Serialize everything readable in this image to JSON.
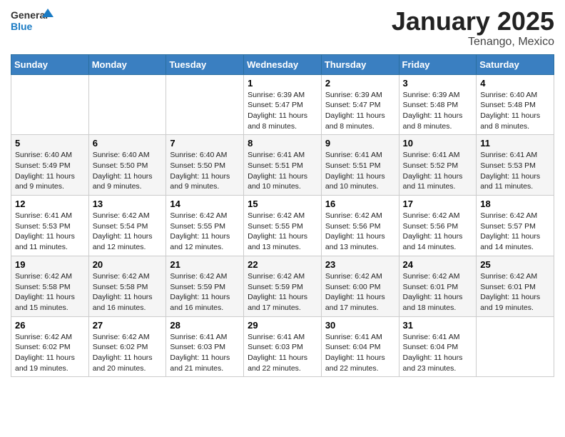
{
  "header": {
    "logo_general": "General",
    "logo_blue": "Blue",
    "month": "January 2025",
    "location": "Tenango, Mexico"
  },
  "weekdays": [
    "Sunday",
    "Monday",
    "Tuesday",
    "Wednesday",
    "Thursday",
    "Friday",
    "Saturday"
  ],
  "weeks": [
    [
      {
        "day": "",
        "info": ""
      },
      {
        "day": "",
        "info": ""
      },
      {
        "day": "",
        "info": ""
      },
      {
        "day": "1",
        "info": "Sunrise: 6:39 AM\nSunset: 5:47 PM\nDaylight: 11 hours and 8 minutes."
      },
      {
        "day": "2",
        "info": "Sunrise: 6:39 AM\nSunset: 5:47 PM\nDaylight: 11 hours and 8 minutes."
      },
      {
        "day": "3",
        "info": "Sunrise: 6:39 AM\nSunset: 5:48 PM\nDaylight: 11 hours and 8 minutes."
      },
      {
        "day": "4",
        "info": "Sunrise: 6:40 AM\nSunset: 5:48 PM\nDaylight: 11 hours and 8 minutes."
      }
    ],
    [
      {
        "day": "5",
        "info": "Sunrise: 6:40 AM\nSunset: 5:49 PM\nDaylight: 11 hours and 9 minutes."
      },
      {
        "day": "6",
        "info": "Sunrise: 6:40 AM\nSunset: 5:50 PM\nDaylight: 11 hours and 9 minutes."
      },
      {
        "day": "7",
        "info": "Sunrise: 6:40 AM\nSunset: 5:50 PM\nDaylight: 11 hours and 9 minutes."
      },
      {
        "day": "8",
        "info": "Sunrise: 6:41 AM\nSunset: 5:51 PM\nDaylight: 11 hours and 10 minutes."
      },
      {
        "day": "9",
        "info": "Sunrise: 6:41 AM\nSunset: 5:51 PM\nDaylight: 11 hours and 10 minutes."
      },
      {
        "day": "10",
        "info": "Sunrise: 6:41 AM\nSunset: 5:52 PM\nDaylight: 11 hours and 11 minutes."
      },
      {
        "day": "11",
        "info": "Sunrise: 6:41 AM\nSunset: 5:53 PM\nDaylight: 11 hours and 11 minutes."
      }
    ],
    [
      {
        "day": "12",
        "info": "Sunrise: 6:41 AM\nSunset: 5:53 PM\nDaylight: 11 hours and 11 minutes."
      },
      {
        "day": "13",
        "info": "Sunrise: 6:42 AM\nSunset: 5:54 PM\nDaylight: 11 hours and 12 minutes."
      },
      {
        "day": "14",
        "info": "Sunrise: 6:42 AM\nSunset: 5:55 PM\nDaylight: 11 hours and 12 minutes."
      },
      {
        "day": "15",
        "info": "Sunrise: 6:42 AM\nSunset: 5:55 PM\nDaylight: 11 hours and 13 minutes."
      },
      {
        "day": "16",
        "info": "Sunrise: 6:42 AM\nSunset: 5:56 PM\nDaylight: 11 hours and 13 minutes."
      },
      {
        "day": "17",
        "info": "Sunrise: 6:42 AM\nSunset: 5:56 PM\nDaylight: 11 hours and 14 minutes."
      },
      {
        "day": "18",
        "info": "Sunrise: 6:42 AM\nSunset: 5:57 PM\nDaylight: 11 hours and 14 minutes."
      }
    ],
    [
      {
        "day": "19",
        "info": "Sunrise: 6:42 AM\nSunset: 5:58 PM\nDaylight: 11 hours and 15 minutes."
      },
      {
        "day": "20",
        "info": "Sunrise: 6:42 AM\nSunset: 5:58 PM\nDaylight: 11 hours and 16 minutes."
      },
      {
        "day": "21",
        "info": "Sunrise: 6:42 AM\nSunset: 5:59 PM\nDaylight: 11 hours and 16 minutes."
      },
      {
        "day": "22",
        "info": "Sunrise: 6:42 AM\nSunset: 5:59 PM\nDaylight: 11 hours and 17 minutes."
      },
      {
        "day": "23",
        "info": "Sunrise: 6:42 AM\nSunset: 6:00 PM\nDaylight: 11 hours and 17 minutes."
      },
      {
        "day": "24",
        "info": "Sunrise: 6:42 AM\nSunset: 6:01 PM\nDaylight: 11 hours and 18 minutes."
      },
      {
        "day": "25",
        "info": "Sunrise: 6:42 AM\nSunset: 6:01 PM\nDaylight: 11 hours and 19 minutes."
      }
    ],
    [
      {
        "day": "26",
        "info": "Sunrise: 6:42 AM\nSunset: 6:02 PM\nDaylight: 11 hours and 19 minutes."
      },
      {
        "day": "27",
        "info": "Sunrise: 6:42 AM\nSunset: 6:02 PM\nDaylight: 11 hours and 20 minutes."
      },
      {
        "day": "28",
        "info": "Sunrise: 6:41 AM\nSunset: 6:03 PM\nDaylight: 11 hours and 21 minutes."
      },
      {
        "day": "29",
        "info": "Sunrise: 6:41 AM\nSunset: 6:03 PM\nDaylight: 11 hours and 22 minutes."
      },
      {
        "day": "30",
        "info": "Sunrise: 6:41 AM\nSunset: 6:04 PM\nDaylight: 11 hours and 22 minutes."
      },
      {
        "day": "31",
        "info": "Sunrise: 6:41 AM\nSunset: 6:04 PM\nDaylight: 11 hours and 23 minutes."
      },
      {
        "day": "",
        "info": ""
      }
    ]
  ]
}
